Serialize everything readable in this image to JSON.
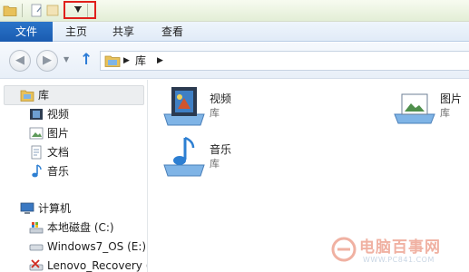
{
  "ribbon": {
    "file_tab": "文件",
    "tabs": [
      {
        "label": "主页"
      },
      {
        "label": "共享"
      },
      {
        "label": "查看"
      }
    ]
  },
  "address": {
    "path": "库",
    "separator": "▶"
  },
  "navpane": {
    "libraries": {
      "label": "库",
      "items": [
        {
          "label": "视频",
          "icon": "video-library-icon"
        },
        {
          "label": "图片",
          "icon": "pictures-library-icon"
        },
        {
          "label": "文档",
          "icon": "documents-library-icon"
        },
        {
          "label": "音乐",
          "icon": "music-library-icon"
        }
      ]
    },
    "computer": {
      "label": "计算机",
      "items": [
        {
          "label": "本地磁盘 (C:)",
          "icon": "local-disk-icon"
        },
        {
          "label": "Windows7_OS (E:)",
          "icon": "drive-icon"
        },
        {
          "label": "Lenovo_Recovery (",
          "icon": "recovery-drive-icon"
        }
      ]
    }
  },
  "content": {
    "libraries": [
      {
        "name": "视频",
        "type": "库",
        "icon": "video-library-icon"
      },
      {
        "name": "图片",
        "type": "库",
        "icon": "pictures-library-icon"
      },
      {
        "name": "音乐",
        "type": "库",
        "icon": "music-library-icon"
      }
    ]
  },
  "watermark": {
    "text": "电脑百事网",
    "url": "WWW.PC841.COM"
  },
  "colors": {
    "file_tab": "#1a5bb0",
    "highlight": "#e0201c",
    "folder": "#e8c15a"
  }
}
